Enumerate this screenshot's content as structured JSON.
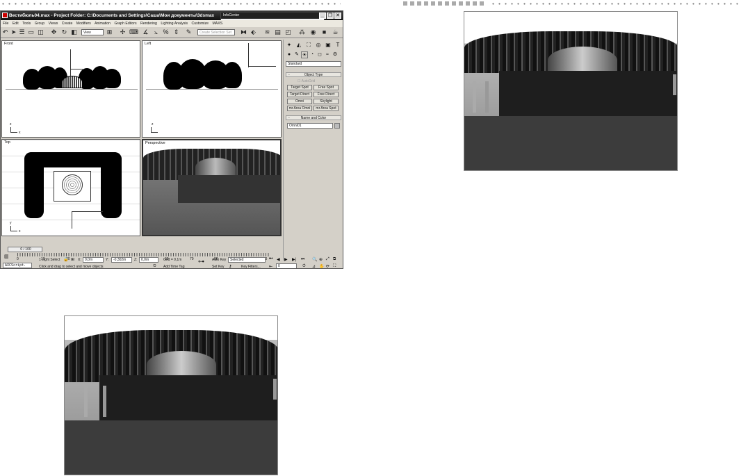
{
  "window": {
    "title": "Вестибюль04.max    - Project Folder: C:\\Documents and Settings\\Саша\\Мои документы\\3dsmax",
    "infocenter_title": "InfoCenter",
    "search_placeholder": "Type a keyword or phrase"
  },
  "menu": [
    "File",
    "Edit",
    "Tools",
    "Group",
    "Views",
    "Create",
    "Modifiers",
    "Animation",
    "Graph Editors",
    "Rendering",
    "Lighting Analysis",
    "Customize",
    "MAXS"
  ],
  "toolbar": {
    "view_select": "View",
    "named_selection": "Create Selection Set"
  },
  "viewports": {
    "front": "Front",
    "left": "Left",
    "top": "Top",
    "perspective": "Perspective"
  },
  "axes": {
    "x": "x",
    "y": "y",
    "z": "z"
  },
  "command_panel": {
    "dropdown": "Standard",
    "object_type_title": "Object Type",
    "autogrid": "AutoGrid",
    "buttons": [
      "Target Spot",
      "Free Spot",
      "Target Direct",
      "Free Direct",
      "Omni",
      "Skylight",
      "mr Area Omni",
      "mr Area Spot"
    ],
    "name_color_title": "Name and Color",
    "object_name": "Omni01"
  },
  "timeline": {
    "slider": "0 / 100",
    "ticks": [
      "0",
      "10",
      "20",
      "30",
      "40",
      "50",
      "60",
      "70",
      "80",
      "90",
      "100"
    ]
  },
  "status": {
    "maxscript": "AXCScript.",
    "selection": "1 Light Select",
    "x_label": "X:",
    "x_value": "0,0m",
    "y_label": "Y:",
    "y_value": "-0,302m",
    "z_label": "Z:",
    "z_value": "0,0m",
    "grid": "Grid = 0,1m",
    "prompt": "Click and drag to select and move objects",
    "add_time_tag": "Add Time Tag",
    "auto_key": "Auto Key",
    "auto_key_mode": "Selected",
    "set_key": "Set Key",
    "key_filters": "Key Filters...",
    "frame": "0"
  }
}
